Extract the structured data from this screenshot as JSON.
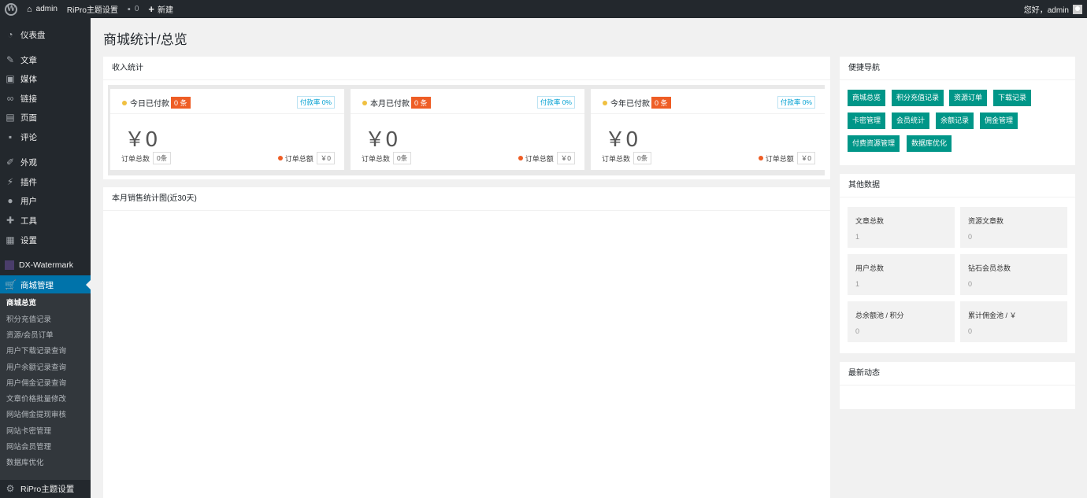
{
  "adminbar": {
    "site_name": "admin",
    "theme_settings": "RiPro主题设置",
    "comments_count": "0",
    "new_label": "新建",
    "greeting": "您好，admin"
  },
  "sidebar": {
    "items": [
      {
        "label": "仪表盘",
        "icon": "dashboard-icon"
      },
      {
        "label": "文章",
        "icon": "pin-icon"
      },
      {
        "label": "媒体",
        "icon": "media-icon"
      },
      {
        "label": "链接",
        "icon": "link-icon"
      },
      {
        "label": "页面",
        "icon": "page-icon"
      },
      {
        "label": "评论",
        "icon": "comment-icon"
      },
      {
        "label": "外观",
        "icon": "brush-icon"
      },
      {
        "label": "插件",
        "icon": "plugin-icon"
      },
      {
        "label": "用户",
        "icon": "user-icon"
      },
      {
        "label": "工具",
        "icon": "wrench-icon"
      },
      {
        "label": "设置",
        "icon": "settings-icon"
      },
      {
        "label": "DX-Watermark",
        "icon": "watermark-icon"
      },
      {
        "label": "商城管理",
        "icon": "cart-icon"
      },
      {
        "label": "RiPro主题设置",
        "icon": "gear-icon"
      }
    ],
    "submenu": [
      "商城总览",
      "积分充值记录",
      "资源/会员订单",
      "用户下载记录查询",
      "用户余额记录查询",
      "用户佣金记录查询",
      "文章价格批量修改",
      "网站佣金提现审核",
      "网站卡密管理",
      "网站会员管理",
      "数据库优化"
    ]
  },
  "page_title": "商城统计/总览",
  "income": {
    "header": "收入统计",
    "boxes": [
      {
        "title": "今日已付款",
        "count": "0 条",
        "rate": "付款率 0%",
        "amount": "￥0",
        "orders_label": "订单总数",
        "orders_value": "0条",
        "total_label": "订单总额",
        "total_value": "￥0"
      },
      {
        "title": "本月已付款",
        "count": "0 条",
        "rate": "付款率 0%",
        "amount": "￥0",
        "orders_label": "订单总数",
        "orders_value": "0条",
        "total_label": "订单总额",
        "total_value": "￥0"
      },
      {
        "title": "今年已付款",
        "count": "0 条",
        "rate": "付款率 0%",
        "amount": "￥0",
        "orders_label": "订单总数",
        "orders_value": "0条",
        "total_label": "订单总额",
        "total_value": "￥0"
      }
    ]
  },
  "sales_chart": {
    "header": "本月销售统计图(近30天)"
  },
  "quick_nav": {
    "header": "便捷导航",
    "buttons": [
      "商城总览",
      "积分充值记录",
      "资源订单",
      "下载记录",
      "卡密管理",
      "会员统计",
      "余额记录",
      "佣金管理",
      "付费资源管理",
      "数据库优化"
    ]
  },
  "other_data": {
    "header": "其他数据",
    "cells": [
      {
        "label": "文章总数",
        "value": "1"
      },
      {
        "label": "资源文章数",
        "value": "0"
      },
      {
        "label": "用户总数",
        "value": "1"
      },
      {
        "label": "钻石会员总数",
        "value": "0"
      },
      {
        "label": "总余额池 / 积分",
        "value": "0"
      },
      {
        "label": "累计佣金池 / ￥",
        "value": "0"
      }
    ]
  },
  "latest": {
    "header": "最新动态"
  },
  "colors": {
    "adminbar": "#23282d",
    "sidebar": "#23282d",
    "submenu": "#32373c",
    "current": "#0073aa",
    "nav_button": "#009688",
    "badge": "#ee5d25",
    "rate": "#00a0d2"
  }
}
